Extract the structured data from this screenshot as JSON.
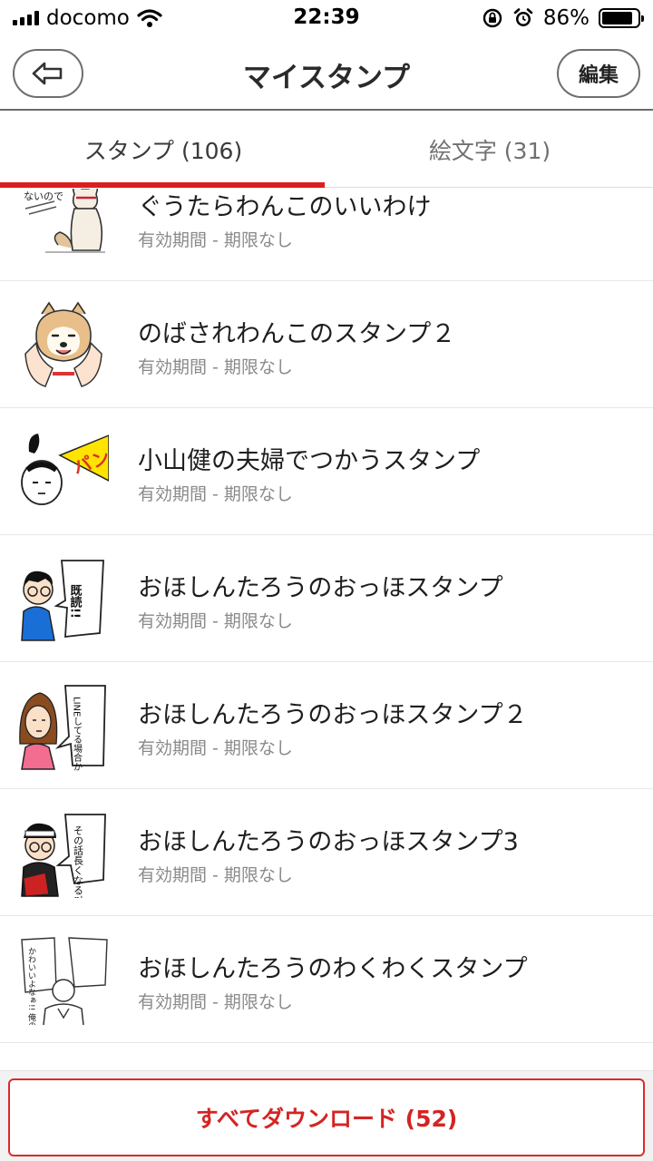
{
  "status_bar": {
    "carrier": "docomo",
    "time": "22:39",
    "battery_percent": "86%",
    "battery_level": 0.86,
    "icons": [
      "signal-icon",
      "wifi-icon",
      "rotation-lock-icon",
      "alarm-icon",
      "battery-icon"
    ]
  },
  "nav": {
    "back_icon": "arrow-left-icon",
    "title": "マイスタンプ",
    "edit_label": "編集"
  },
  "tabs": [
    {
      "label": "スタンプ (106)",
      "selected": true
    },
    {
      "label": "絵文字 (31)",
      "selected": false
    }
  ],
  "colors": {
    "accent": "#dc1e1e",
    "text": "#1e1e1e",
    "subtext": "#8a8a8a"
  },
  "list": {
    "items": [
      {
        "title": "ぐうたらわんこのいいわけ",
        "subtitle": "有効期間 - 期限なし",
        "thumb_text": "ないので"
      },
      {
        "title": "のばされわんこのスタンプ２",
        "subtitle": "有効期間 - 期限なし"
      },
      {
        "title": "小山健の夫婦でつかうスタンプ",
        "subtitle": "有効期間 - 期限なし",
        "thumb_text": "パン"
      },
      {
        "title": "おほしんたろうのおっほスタンプ",
        "subtitle": "有効期間 - 期限なし",
        "thumb_text": "既読!!"
      },
      {
        "title": "おほしんたろうのおっほスタンプ２",
        "subtitle": "有効期間 - 期限なし",
        "thumb_text": "LINEしてる場合かね?"
      },
      {
        "title": "おほしんたろうのおっほスタンプ3",
        "subtitle": "有効期間 - 期限なし",
        "thumb_text": "その話長くなる?"
      },
      {
        "title": "おほしんたろうのわくわくスタンプ",
        "subtitle": "有効期間 - 期限なし",
        "thumb_text": "かわいいよなぁ!! 俺のこういうとこ"
      }
    ]
  },
  "bottom": {
    "download_label": "すべてダウンロード (52)"
  }
}
